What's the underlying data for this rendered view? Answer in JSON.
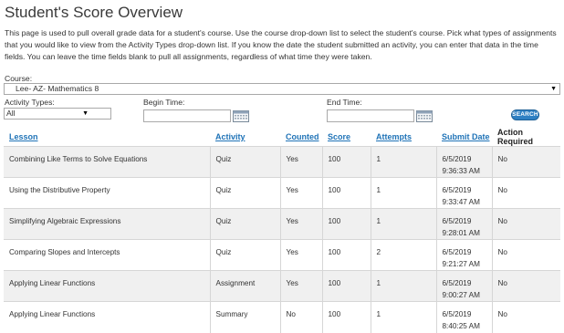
{
  "page": {
    "title": "Student's Score Overview",
    "intro": "This page is used to pull overall grade data for a student's course. Use the course drop-down list to select the student's course. Pick what types of assignments that you would like to view from the Activity Types drop-down list. If you know the date the student submitted an activity, you can enter that data in the time fields. You can leave the time fields blank to pull all assignments, regardless of what time they were taken."
  },
  "filters": {
    "course_label": "Course:",
    "course_value": "Lee- AZ- Mathematics 8",
    "types_label": "Activity Types:",
    "types_value": "All",
    "begin_label": "Begin Time:",
    "begin_value": "",
    "end_label": "End Time:",
    "end_value": "",
    "search_label": "SEARCH"
  },
  "table": {
    "headers": [
      "Lesson",
      "Activity",
      "Counted",
      "Score",
      "Attempts",
      "Submit Date",
      "Action Required"
    ],
    "rows": [
      {
        "lesson": "Combining Like Terms to Solve Equations",
        "activity": "Quiz",
        "counted": "Yes",
        "score": "100",
        "attempts": "1",
        "date": "6/5/2019",
        "time": "9:36:33 AM",
        "action": "No"
      },
      {
        "lesson": "Using the Distributive Property",
        "activity": "Quiz",
        "counted": "Yes",
        "score": "100",
        "attempts": "1",
        "date": "6/5/2019",
        "time": "9:33:47 AM",
        "action": "No"
      },
      {
        "lesson": "Simplifying Algebraic Expressions",
        "activity": "Quiz",
        "counted": "Yes",
        "score": "100",
        "attempts": "1",
        "date": "6/5/2019",
        "time": "9:28:01 AM",
        "action": "No"
      },
      {
        "lesson": "Comparing Slopes and Intercepts",
        "activity": "Quiz",
        "counted": "Yes",
        "score": "100",
        "attempts": "2",
        "date": "6/5/2019",
        "time": "9:21:27 AM",
        "action": "No"
      },
      {
        "lesson": "Applying Linear Functions",
        "activity": "Assignment",
        "counted": "Yes",
        "score": "100",
        "attempts": "1",
        "date": "6/5/2019",
        "time": "9:00:27 AM",
        "action": "No"
      },
      {
        "lesson": "Applying Linear Functions",
        "activity": "Summary",
        "counted": "No",
        "score": "100",
        "attempts": "1",
        "date": "6/5/2019",
        "time": "8:40:25 AM",
        "action": "No"
      }
    ]
  },
  "icons": {
    "dropdown": "dropdown-arrow-icon",
    "calendar": "calendar-icon"
  },
  "colors": {
    "link": "#1f73b7",
    "search_button": "#2f80c3",
    "row_alt": "#f0f0f0",
    "border": "#d6d6d6"
  }
}
